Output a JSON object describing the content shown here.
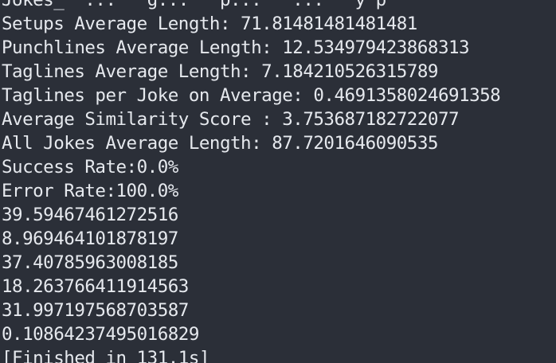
{
  "output": {
    "partial_top_line": "Jokes_  ...   g...   p...   ...   y p",
    "lines": [
      "Setups Average Length: 71.81481481481481",
      "Punchlines Average Length: 12.534979423868313",
      "Taglines Average Length: 7.184210526315789",
      "Taglines per Joke on Average: 0.4691358024691358",
      "Average Similarity Score : 3.753687182722077",
      "All Jokes Average Length: 87.7201646090535",
      "Success Rate:0.0%",
      "Error Rate:100.0%",
      "39.59467461272516",
      "8.969464101878197",
      "37.40785963008185",
      "18.263766411914563",
      "31.997197568703587",
      "0.10864237495016829",
      "[Finished in 131.1s]"
    ]
  },
  "colors": {
    "background": "#2b2f38",
    "text": "#e6e9ee"
  }
}
